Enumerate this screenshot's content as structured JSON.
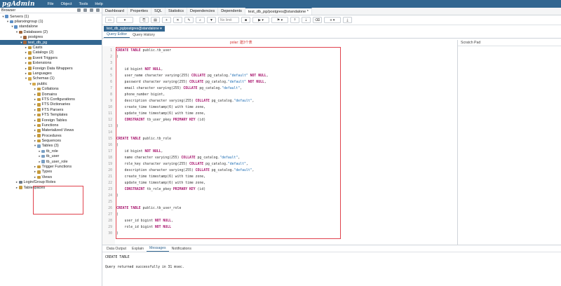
{
  "app": {
    "logo": "pgAdmin"
  },
  "menu": [
    "File",
    "Object",
    "Tools",
    "Help"
  ],
  "browser": {
    "title": "Browser"
  },
  "tree": [
    {
      "label": "Servers (1)",
      "depth": 0,
      "arrow": "▾",
      "icon": "srv"
    },
    {
      "label": "pilanxingroup (1)",
      "depth": 1,
      "arrow": "▾",
      "icon": "srv"
    },
    {
      "label": "standalone",
      "depth": 2,
      "arrow": "▾",
      "icon": "srv"
    },
    {
      "label": "Databases (2)",
      "depth": 3,
      "arrow": "▾",
      "icon": "db"
    },
    {
      "label": "postgres",
      "depth": 4,
      "arrow": "▸",
      "icon": "db"
    },
    {
      "label": "test_db_pg",
      "depth": 4,
      "arrow": "▾",
      "icon": "db",
      "selected": true
    },
    {
      "label": "Casts",
      "depth": 5,
      "arrow": "▸",
      "icon": "grp"
    },
    {
      "label": "Catalogs (2)",
      "depth": 5,
      "arrow": "▸",
      "icon": "grp"
    },
    {
      "label": "Event Triggers",
      "depth": 5,
      "arrow": "▸",
      "icon": "grp"
    },
    {
      "label": "Extensions",
      "depth": 5,
      "arrow": "▸",
      "icon": "grp"
    },
    {
      "label": "Foreign Data Wrappers",
      "depth": 5,
      "arrow": "▸",
      "icon": "grp"
    },
    {
      "label": "Languages",
      "depth": 5,
      "arrow": "▸",
      "icon": "grp"
    },
    {
      "label": "Schemas (1)",
      "depth": 5,
      "arrow": "▾",
      "icon": "sch"
    },
    {
      "label": "public",
      "depth": 6,
      "arrow": "▾",
      "icon": "sch"
    },
    {
      "label": "Collations",
      "depth": 7,
      "arrow": "▸",
      "icon": "grp"
    },
    {
      "label": "Domains",
      "depth": 7,
      "arrow": "▸",
      "icon": "grp"
    },
    {
      "label": "FTS Configurations",
      "depth": 7,
      "arrow": "▸",
      "icon": "grp"
    },
    {
      "label": "FTS Dictionaries",
      "depth": 7,
      "arrow": "▸",
      "icon": "grp"
    },
    {
      "label": "FTS Parsers",
      "depth": 7,
      "arrow": "▸",
      "icon": "grp"
    },
    {
      "label": "FTS Templates",
      "depth": 7,
      "arrow": "▸",
      "icon": "grp"
    },
    {
      "label": "Foreign Tables",
      "depth": 7,
      "arrow": "▸",
      "icon": "grp"
    },
    {
      "label": "Functions",
      "depth": 7,
      "arrow": "▸",
      "icon": "grp"
    },
    {
      "label": "Materialized Views",
      "depth": 7,
      "arrow": "▸",
      "icon": "grp"
    },
    {
      "label": "Procedures",
      "depth": 7,
      "arrow": "▸",
      "icon": "grp"
    },
    {
      "label": "Sequences",
      "depth": 7,
      "arrow": "▸",
      "icon": "grp"
    },
    {
      "label": "Tables (3)",
      "depth": 7,
      "arrow": "▾",
      "icon": "tbl"
    },
    {
      "label": "tb_role",
      "depth": 8,
      "arrow": "▸",
      "icon": "tbl"
    },
    {
      "label": "tb_user",
      "depth": 8,
      "arrow": "▸",
      "icon": "tbl"
    },
    {
      "label": "tb_user_role",
      "depth": 8,
      "arrow": "▸",
      "icon": "tbl"
    },
    {
      "label": "Trigger Functions",
      "depth": 7,
      "arrow": "▸",
      "icon": "grp"
    },
    {
      "label": "Types",
      "depth": 7,
      "arrow": "▸",
      "icon": "grp"
    },
    {
      "label": "Views",
      "depth": 7,
      "arrow": "▸",
      "icon": "grp"
    },
    {
      "label": "Login/Group Roles",
      "depth": 3,
      "arrow": "▸",
      "icon": "usr"
    },
    {
      "label": "Tablespaces",
      "depth": 3,
      "arrow": "▸",
      "icon": "grp"
    }
  ],
  "tabs": [
    {
      "label": "Dashboard"
    },
    {
      "label": "Properties"
    },
    {
      "label": "SQL"
    },
    {
      "label": "Statistics"
    },
    {
      "label": "Dependencies"
    },
    {
      "label": "Dependents"
    },
    {
      "label": "test_db_pg/postgres@standalone *",
      "active": true
    }
  ],
  "toolbar": {
    "limit_placeholder": "No limit"
  },
  "connection": {
    "label": "test_db_pg/postgres@standalone"
  },
  "query_tabs": [
    {
      "label": "Query Editor",
      "active": true
    },
    {
      "label": "Query History"
    }
  ],
  "annotation": "polar: 建3个表",
  "scratch": {
    "title": "Scratch Pad"
  },
  "code": [
    {
      "n": "1",
      "segs": [
        [
          "kw",
          "CREATE TABLE "
        ],
        [
          "ty",
          "public.tb_user"
        ]
      ]
    },
    {
      "n": "2",
      "segs": [
        [
          "ty",
          "("
        ]
      ]
    },
    {
      "n": "3",
      "segs": [
        [
          "ty",
          ""
        ]
      ]
    },
    {
      "n": "4",
      "segs": [
        [
          "ty",
          "    id bigint "
        ],
        [
          "kw",
          "NOT NULL"
        ],
        [
          "ty",
          ","
        ]
      ]
    },
    {
      "n": "5",
      "segs": [
        [
          "ty",
          "    user_name character varying(255) "
        ],
        [
          "kw",
          "COLLATE "
        ],
        [
          "ty",
          "pg_catalog."
        ],
        [
          "str",
          "\"default\""
        ],
        [
          "ty",
          " "
        ],
        [
          "kw",
          "NOT NULL"
        ],
        [
          "ty",
          ","
        ]
      ]
    },
    {
      "n": "6",
      "segs": [
        [
          "ty",
          "    password character varying(255) "
        ],
        [
          "kw",
          "COLLATE "
        ],
        [
          "ty",
          "pg_catalog."
        ],
        [
          "str",
          "\"default\""
        ],
        [
          "ty",
          " "
        ],
        [
          "kw",
          "NOT NULL"
        ],
        [
          "ty",
          ","
        ]
      ]
    },
    {
      "n": "7",
      "segs": [
        [
          "ty",
          "    email character varying(255) "
        ],
        [
          "kw",
          "COLLATE "
        ],
        [
          "ty",
          "pg_catalog."
        ],
        [
          "str",
          "\"default\""
        ],
        [
          "ty",
          ","
        ]
      ]
    },
    {
      "n": "8",
      "segs": [
        [
          "ty",
          "    phone_number bigint,"
        ]
      ]
    },
    {
      "n": "9",
      "segs": [
        [
          "ty",
          "    description character varying(255) "
        ],
        [
          "kw",
          "COLLATE "
        ],
        [
          "ty",
          "pg_catalog."
        ],
        [
          "str",
          "\"default\""
        ],
        [
          "ty",
          ","
        ]
      ]
    },
    {
      "n": "10",
      "segs": [
        [
          "ty",
          "    create_time timestamp(6) with time zone,"
        ]
      ]
    },
    {
      "n": "11",
      "segs": [
        [
          "ty",
          "    update_time timestamp(6) with time zone,"
        ]
      ]
    },
    {
      "n": "12",
      "segs": [
        [
          "ty",
          "    "
        ],
        [
          "kw",
          "CONSTRAINT "
        ],
        [
          "ty",
          "tb_user_pkey "
        ],
        [
          "kw",
          "PRIMARY KEY "
        ],
        [
          "ty",
          "(id)"
        ]
      ]
    },
    {
      "n": "13",
      "segs": [
        [
          "ty",
          ")"
        ]
      ]
    },
    {
      "n": "14",
      "segs": [
        [
          "ty",
          ""
        ]
      ]
    },
    {
      "n": "15",
      "segs": [
        [
          "kw",
          "CREATE TABLE "
        ],
        [
          "ty",
          "public.tb_role"
        ]
      ]
    },
    {
      "n": "16",
      "segs": [
        [
          "ty",
          "("
        ]
      ]
    },
    {
      "n": "17",
      "segs": [
        [
          "ty",
          "    id bigint "
        ],
        [
          "kw",
          "NOT NULL"
        ],
        [
          "ty",
          ","
        ]
      ]
    },
    {
      "n": "18",
      "segs": [
        [
          "ty",
          "    name character varying(255) "
        ],
        [
          "kw",
          "COLLATE "
        ],
        [
          "ty",
          "pg_catalog."
        ],
        [
          "str",
          "\"default\""
        ],
        [
          "ty",
          ","
        ]
      ]
    },
    {
      "n": "19",
      "segs": [
        [
          "ty",
          "    role_key character varying(255) "
        ],
        [
          "kw",
          "COLLATE "
        ],
        [
          "ty",
          "pg_catalog."
        ],
        [
          "str",
          "\"default\""
        ],
        [
          "ty",
          ","
        ]
      ]
    },
    {
      "n": "20",
      "segs": [
        [
          "ty",
          "    description character varying(255) "
        ],
        [
          "kw",
          "COLLATE "
        ],
        [
          "ty",
          "pg_catalog."
        ],
        [
          "str",
          "\"default\""
        ],
        [
          "ty",
          ","
        ]
      ]
    },
    {
      "n": "21",
      "segs": [
        [
          "ty",
          "    create_time timestamp(6) with time zone,"
        ]
      ]
    },
    {
      "n": "22",
      "segs": [
        [
          "ty",
          "    update_time timestamp(6) with time zone,"
        ]
      ]
    },
    {
      "n": "23",
      "segs": [
        [
          "ty",
          "    "
        ],
        [
          "kw",
          "CONSTRAINT "
        ],
        [
          "ty",
          "tb_role_pkey "
        ],
        [
          "kw",
          "PRIMARY KEY "
        ],
        [
          "ty",
          "(id)"
        ]
      ]
    },
    {
      "n": "24",
      "segs": [
        [
          "ty",
          ")"
        ]
      ]
    },
    {
      "n": "25",
      "segs": [
        [
          "ty",
          ""
        ]
      ]
    },
    {
      "n": "26",
      "segs": [
        [
          "kw",
          "CREATE TABLE "
        ],
        [
          "ty",
          "public.tb_user_role"
        ]
      ]
    },
    {
      "n": "27",
      "segs": [
        [
          "ty",
          "("
        ]
      ]
    },
    {
      "n": "28",
      "segs": [
        [
          "ty",
          "    user_id bigint "
        ],
        [
          "kw",
          "NOT NULL"
        ],
        [
          "ty",
          ","
        ]
      ]
    },
    {
      "n": "29",
      "segs": [
        [
          "ty",
          "    role_id bigint "
        ],
        [
          "kw",
          "NOT NULL"
        ]
      ]
    },
    {
      "n": "30",
      "segs": [
        [
          "ty",
          ")"
        ]
      ]
    }
  ],
  "bottom_tabs": [
    {
      "label": "Data Output"
    },
    {
      "label": "Explain"
    },
    {
      "label": "Messages",
      "active": true
    },
    {
      "label": "Notifications"
    }
  ],
  "messages": {
    "line1": "CREATE TABLE",
    "line2": "Query returned successfully in 31 msec."
  }
}
